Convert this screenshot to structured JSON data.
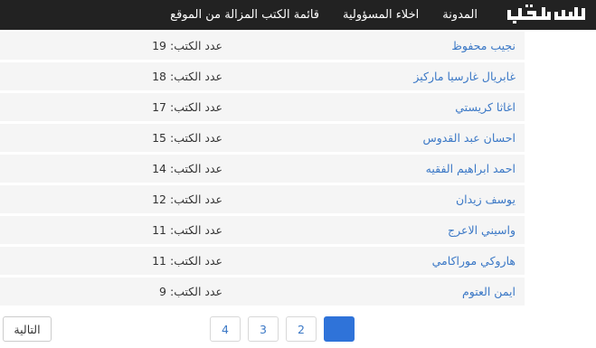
{
  "navbar": {
    "brand_logo": "logo",
    "links": [
      {
        "label": "المدونة"
      },
      {
        "label": "اخلاء المسؤولية"
      },
      {
        "label": "قائمة الكتب المزالة من الموقع"
      }
    ]
  },
  "count_label": "عدد الكتب:",
  "authors": [
    {
      "name": "نجيب محفوظ",
      "count": "19"
    },
    {
      "name": "غابريال غارسيا ماركيز",
      "count": "18"
    },
    {
      "name": "اغاثا كريستي",
      "count": "17"
    },
    {
      "name": "احسان عبد القدوس",
      "count": "15"
    },
    {
      "name": "احمد ابراهيم الفقيه",
      "count": "14"
    },
    {
      "name": "يوسف زيدان",
      "count": "12"
    },
    {
      "name": "واسيني الاعرج",
      "count": "11"
    },
    {
      "name": "هاروكي موراكامي",
      "count": "11"
    },
    {
      "name": "ايمن العتوم",
      "count": "9"
    }
  ],
  "pagination": {
    "pages": [
      {
        "label": "",
        "active": true
      },
      {
        "label": "2",
        "active": false
      },
      {
        "label": "3",
        "active": false
      },
      {
        "label": "4",
        "active": false
      }
    ],
    "next_label": "التالية"
  },
  "colors": {
    "navbar_bg": "#222222",
    "link": "#3b78c6",
    "row_bg": "#f5f5f5",
    "active_page": "#2f73d9"
  }
}
